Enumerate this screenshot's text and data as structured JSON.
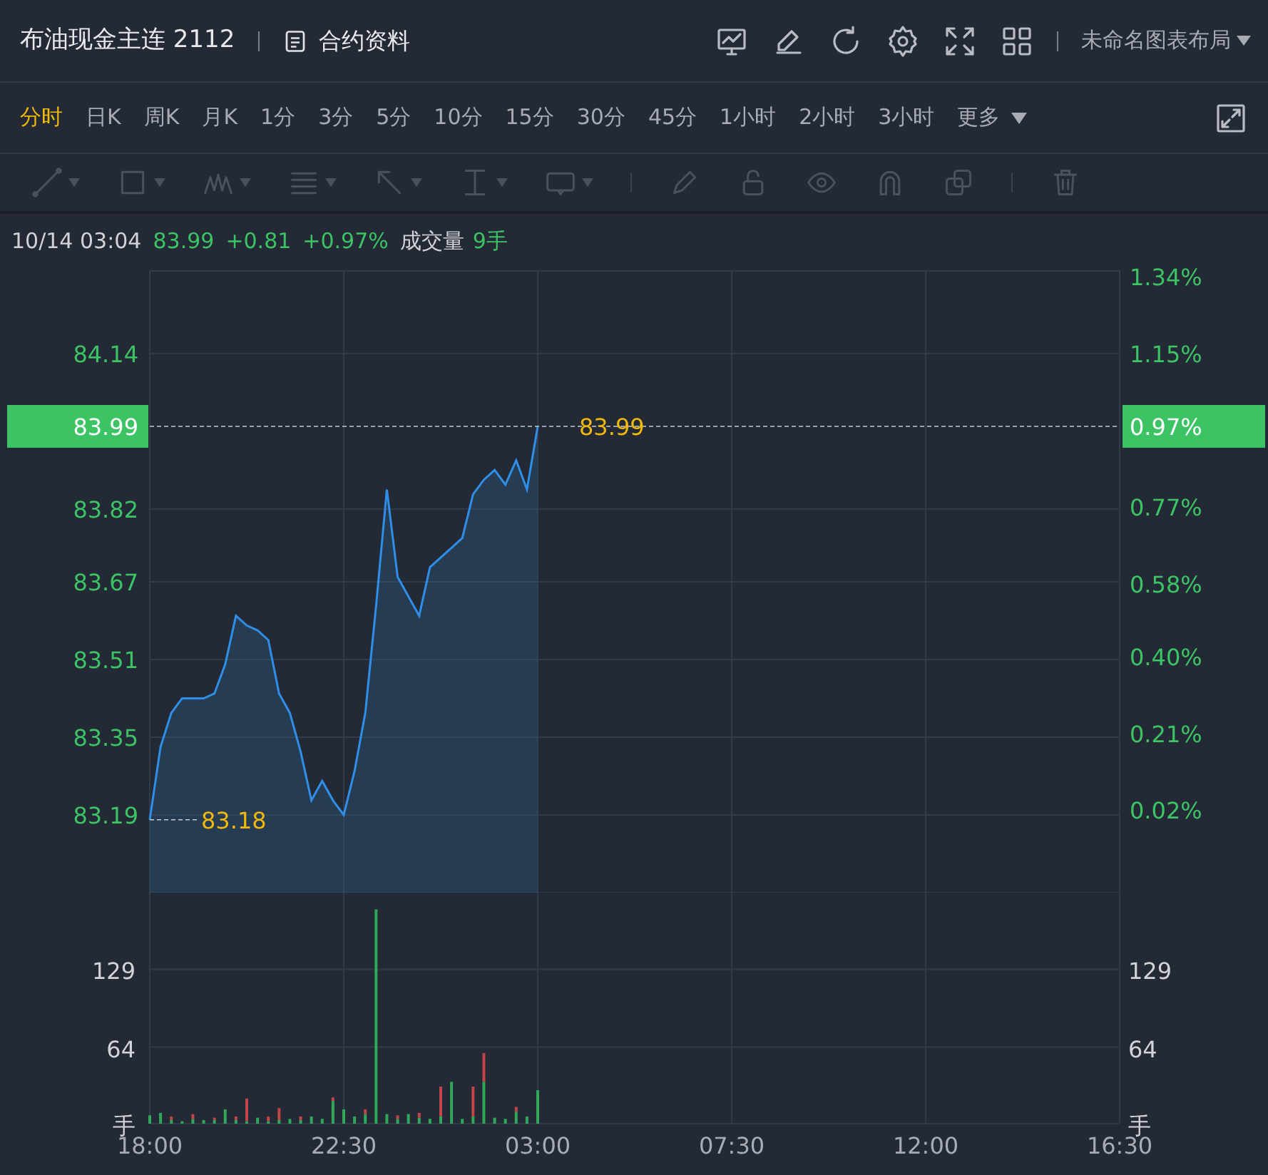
{
  "header": {
    "title": "布油现金主连 2112",
    "info_link": "合约资料",
    "layout_menu": "未命名图表布局"
  },
  "timeframes": [
    {
      "label": "分时",
      "selected": true
    },
    {
      "label": "日K",
      "selected": false
    },
    {
      "label": "周K",
      "selected": false
    },
    {
      "label": "月K",
      "selected": false
    },
    {
      "label": "1分",
      "selected": false
    },
    {
      "label": "3分",
      "selected": false
    },
    {
      "label": "5分",
      "selected": false
    },
    {
      "label": "10分",
      "selected": false
    },
    {
      "label": "15分",
      "selected": false
    },
    {
      "label": "30分",
      "selected": false
    },
    {
      "label": "45分",
      "selected": false
    },
    {
      "label": "1小时",
      "selected": false
    },
    {
      "label": "2小时",
      "selected": false
    },
    {
      "label": "3小时",
      "selected": false
    }
  ],
  "more_menu": "更多",
  "drawing_toolbar": {
    "disabled": true
  },
  "quote": {
    "time": "10/14 03:04",
    "price": "83.99",
    "change": "+0.81",
    "change_pct": "+0.97%",
    "volume_label": "成交量",
    "volume": "9手"
  },
  "price_chart": {
    "last_price_axis": "83.99",
    "last_pct_axis": "0.97%",
    "low_label": "83.18",
    "right_axis_labels": [
      "1.34%",
      "1.15%",
      "0.77%",
      "0.58%",
      "0.40%",
      "0.21%",
      "0.02%"
    ],
    "chart_data": {
      "type": "area",
      "grid": true,
      "categories": [
        null,
        null,
        null,
        null,
        null,
        null,
        null,
        null,
        null,
        null,
        null,
        null,
        null,
        null,
        null,
        null,
        null,
        null,
        null,
        null,
        null,
        null,
        null,
        null,
        null,
        null,
        null,
        null,
        null,
        null,
        null,
        null,
        null,
        null,
        null,
        null,
        null,
        null,
        null,
        null,
        null,
        null,
        null,
        null,
        null,
        null,
        null,
        null,
        null,
        null,
        null,
        null,
        null,
        null,
        null,
        null,
        null,
        null,
        null,
        null,
        null,
        null,
        null,
        null,
        null,
        null,
        null,
        null,
        null,
        null,
        null,
        null,
        null,
        null,
        null,
        null,
        null,
        null,
        null,
        null,
        null,
        null,
        null,
        null,
        null,
        null,
        null,
        null,
        null,
        null,
        null
      ],
      "series": [
        {
          "color": "#2f8fe8",
          "values": [
            83.18,
            83.33,
            83.4,
            83.43,
            83.43,
            83.43,
            83.44,
            83.5,
            83.6,
            83.58,
            83.57,
            83.55,
            83.44,
            83.4,
            83.32,
            83.22,
            83.26,
            83.22,
            83.19,
            83.28,
            83.4,
            83.62,
            83.86,
            83.68,
            83.64,
            83.6,
            83.7,
            83.72,
            83.74,
            83.76,
            83.85,
            83.88,
            83.9,
            83.87,
            83.92,
            83.86,
            83.99,
            null,
            null,
            null,
            null,
            null,
            null,
            null,
            null,
            null,
            null,
            null,
            null,
            null,
            null,
            null,
            null,
            null,
            null,
            null,
            null,
            null,
            null,
            null,
            null,
            null,
            null,
            null,
            null,
            null,
            null,
            null,
            null,
            null,
            null,
            null,
            null,
            null,
            null,
            null,
            null,
            null,
            null,
            null,
            null,
            null,
            null,
            null,
            null,
            null,
            null,
            null,
            null,
            null,
            null
          ]
        }
      ],
      "ref_lines": [
        {
          "axis": "y",
          "value": 83.99,
          "label": "83.99"
        }
      ],
      "ylim": [
        83.03,
        84.31
      ],
      "yticks": [
        84.14,
        83.82,
        83.67,
        83.51,
        83.35,
        83.19
      ]
    }
  },
  "volume_chart": {
    "right_labels": [
      "129",
      "64",
      "手"
    ],
    "chart_data": {
      "type": "bar",
      "stacked": true,
      "grid": true,
      "categories": [
        "18:00",
        null,
        null,
        null,
        null,
        null,
        null,
        null,
        null,
        null,
        null,
        null,
        null,
        null,
        null,
        null,
        null,
        null,
        "22:30",
        null,
        null,
        null,
        null,
        null,
        null,
        null,
        null,
        null,
        null,
        null,
        null,
        null,
        null,
        null,
        null,
        null,
        "03:00",
        null,
        null,
        null,
        null,
        null,
        null,
        null,
        null,
        null,
        null,
        null,
        null,
        null,
        null,
        null,
        null,
        null,
        "07:30",
        null,
        null,
        null,
        null,
        null,
        null,
        null,
        null,
        null,
        null,
        null,
        null,
        null,
        null,
        null,
        null,
        null,
        "12:00",
        null,
        null,
        null,
        null,
        null,
        null,
        null,
        null,
        null,
        null,
        null,
        null,
        null,
        null,
        null,
        null,
        null,
        "16:30"
      ],
      "series": [
        {
          "color": "#2fa85a",
          "values": [
            7,
            9,
            3,
            2,
            4,
            3,
            3,
            12,
            3,
            2,
            5,
            2,
            3,
            4,
            3,
            6,
            4,
            19,
            12,
            6,
            8,
            179,
            8,
            4,
            8,
            5,
            4,
            6,
            35,
            4,
            6,
            35,
            5,
            4,
            10,
            6,
            28,
            null,
            null,
            null,
            null,
            null,
            null,
            null,
            null,
            null,
            null,
            null,
            null,
            null,
            null,
            null,
            null,
            null,
            null,
            null,
            null,
            null,
            null,
            null,
            null,
            null,
            null,
            null,
            null,
            null,
            null,
            null,
            null,
            null,
            null,
            null,
            null,
            null,
            null,
            null,
            null,
            null,
            null,
            null,
            null,
            null,
            null,
            null,
            null,
            null,
            null,
            null,
            null,
            null,
            null
          ]
        },
        {
          "color": "#c0444a",
          "values": [
            0,
            0,
            3,
            0,
            4,
            0,
            2,
            0,
            3,
            19,
            0,
            4,
            10,
            0,
            3,
            0,
            0,
            3,
            0,
            0,
            4,
            0,
            0,
            3,
            0,
            4,
            0,
            25,
            0,
            0,
            25,
            24,
            0,
            0,
            4,
            0,
            0,
            null,
            null,
            null,
            null,
            null,
            null,
            null,
            null,
            null,
            null,
            null,
            null,
            null,
            null,
            null,
            null,
            null,
            null,
            null,
            null,
            null,
            null,
            null,
            null,
            null,
            null,
            null,
            null,
            null,
            null,
            null,
            null,
            null,
            null,
            null,
            null,
            null,
            null,
            null,
            null,
            null,
            null,
            null,
            null,
            null,
            null,
            null,
            null,
            null,
            null,
            null,
            null,
            null,
            null
          ]
        }
      ],
      "ylim": [
        0,
        193
      ],
      "yticks": [
        {
          "value": 129,
          "label": "129"
        },
        {
          "value": 64,
          "label": "64"
        },
        {
          "value": 0,
          "label": "手"
        }
      ]
    }
  }
}
